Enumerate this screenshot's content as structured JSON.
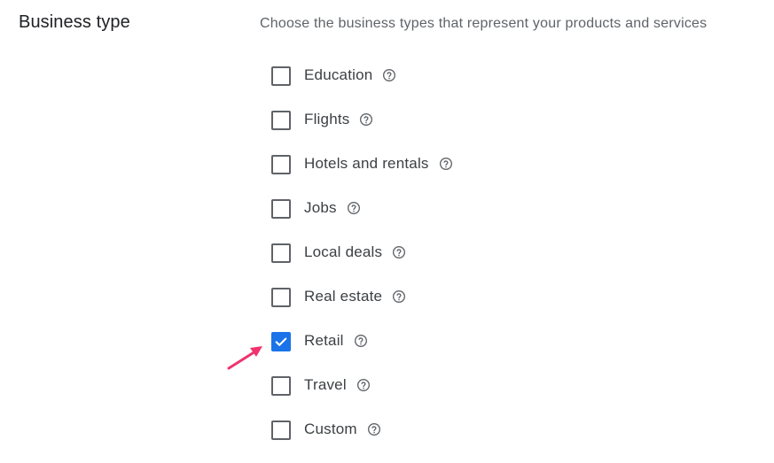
{
  "section": {
    "title": "Business type",
    "description": "Choose the business types that represent your products and services"
  },
  "options": [
    {
      "label": "Education",
      "checked": false
    },
    {
      "label": "Flights",
      "checked": false
    },
    {
      "label": "Hotels and rentals",
      "checked": false
    },
    {
      "label": "Jobs",
      "checked": false
    },
    {
      "label": "Local deals",
      "checked": false
    },
    {
      "label": "Real estate",
      "checked": false
    },
    {
      "label": "Retail",
      "checked": true
    },
    {
      "label": "Travel",
      "checked": false
    },
    {
      "label": "Custom",
      "checked": false
    }
  ],
  "colors": {
    "accent": "#1a73e8",
    "annotation_arrow": "#f0326e"
  },
  "icons": {
    "help": "help-circle-icon",
    "check": "check-icon",
    "arrow": "arrow-annotation-icon"
  }
}
